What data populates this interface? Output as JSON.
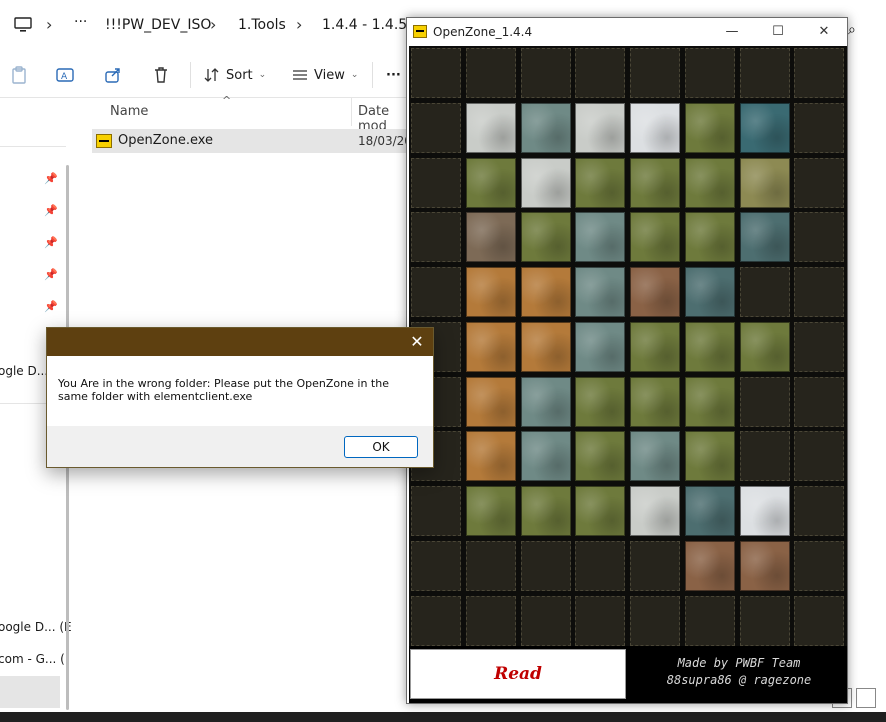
{
  "explorer": {
    "breadcrumbs": [
      "!!!PW_DEV_ISO",
      "1.Tools",
      "1.4.4 - 1.4.5"
    ],
    "more_crumbs": "···",
    "toolbar": {
      "sort_label": "Sort",
      "view_label": "View",
      "more_label": "···"
    },
    "columns": {
      "name": "Name",
      "date": "Date mod"
    },
    "files": [
      {
        "name": "OpenZone.exe",
        "date": "18/03/202"
      }
    ],
    "sidebar_fragments": [
      "ogle D...",
      "oogle D... (E",
      "com - G... (I"
    ]
  },
  "openzone": {
    "window_title": "OpenZone_1.4.4",
    "read_label": "Read",
    "credit_line1": "Made by PWBF Team",
    "credit_line2": "88supra86 @ ragezone",
    "grid": {
      "cols": 8,
      "rows": 11,
      "cells": [
        "........",
        ".SRSIFO.",
        ".FSFFFG.",
        ".MFRFFW.",
        ".DDRCW..",
        ".DDRFFF.",
        ".DRFFF..",
        ".DRFRF..",
        ".FFFSWI.",
        ".....CC.",
        "........"
      ],
      "terrain_colors": {
        "S": "#c9ccc8",
        "R": "#6f8a86",
        "I": "#dcdfe2",
        "F": "#6e7a3c",
        "O": "#3a6a72",
        "G": "#8d8a53",
        "M": "#7d6a56",
        "W": "#4d6e70",
        "D": "#b47a3a",
        "C": "#8a6246"
      }
    }
  },
  "dialog": {
    "close_symbol": "✕",
    "message": "You Are in the wrong folder: Please put the OpenZone in the same folder with elementclient.exe",
    "ok_label": "OK",
    "title_color": "#5e4010"
  }
}
